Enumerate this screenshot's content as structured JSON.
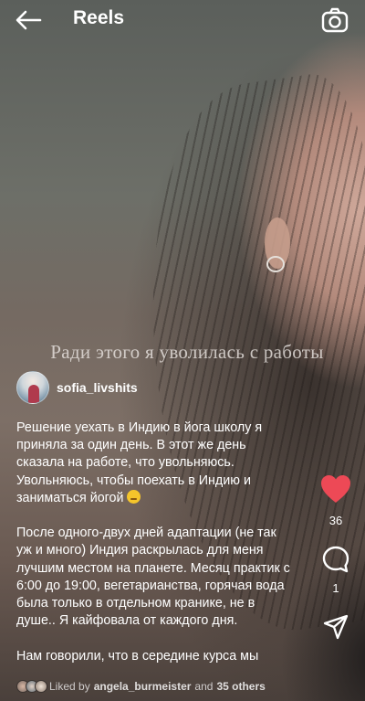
{
  "header": {
    "title": "Reels",
    "back_icon": "arrow-left-icon",
    "camera_icon": "camera-icon"
  },
  "video": {
    "overlay_caption": "Ради этого я уволилась с работы"
  },
  "author": {
    "username": "sofia_livshits"
  },
  "description": {
    "paragraphs": [
      "Решение уехать в Индию в йога школу я приняла за один день. В этот же день сказала на работе, что увольняюсь. Увольняюсь, чтобы поехать в Индию и заниматься йогой",
      "После одного-двух дней адаптации (не так уж и много) Индия раскрылась для меня лучшим местом на планете. Месяц практик с 6:00 до 19:00, вегетарианства, горячая вода была только в отдельном кранике, не в душе.. Я кайфовала от каждого дня.",
      "Нам говорили, что в середине курса мы устанем и нам надоест. У меня этого не"
    ],
    "emoji": "shushing-face-emoji"
  },
  "actions": {
    "like_count": "36",
    "comment_count": "1",
    "like_icon": "heart-icon",
    "comment_icon": "comment-icon",
    "share_icon": "send-icon",
    "like_color": "#ed4956"
  },
  "likes": {
    "prefix": "Liked by",
    "user": "angela_burmeister",
    "joiner": "and",
    "others": "35 others"
  }
}
